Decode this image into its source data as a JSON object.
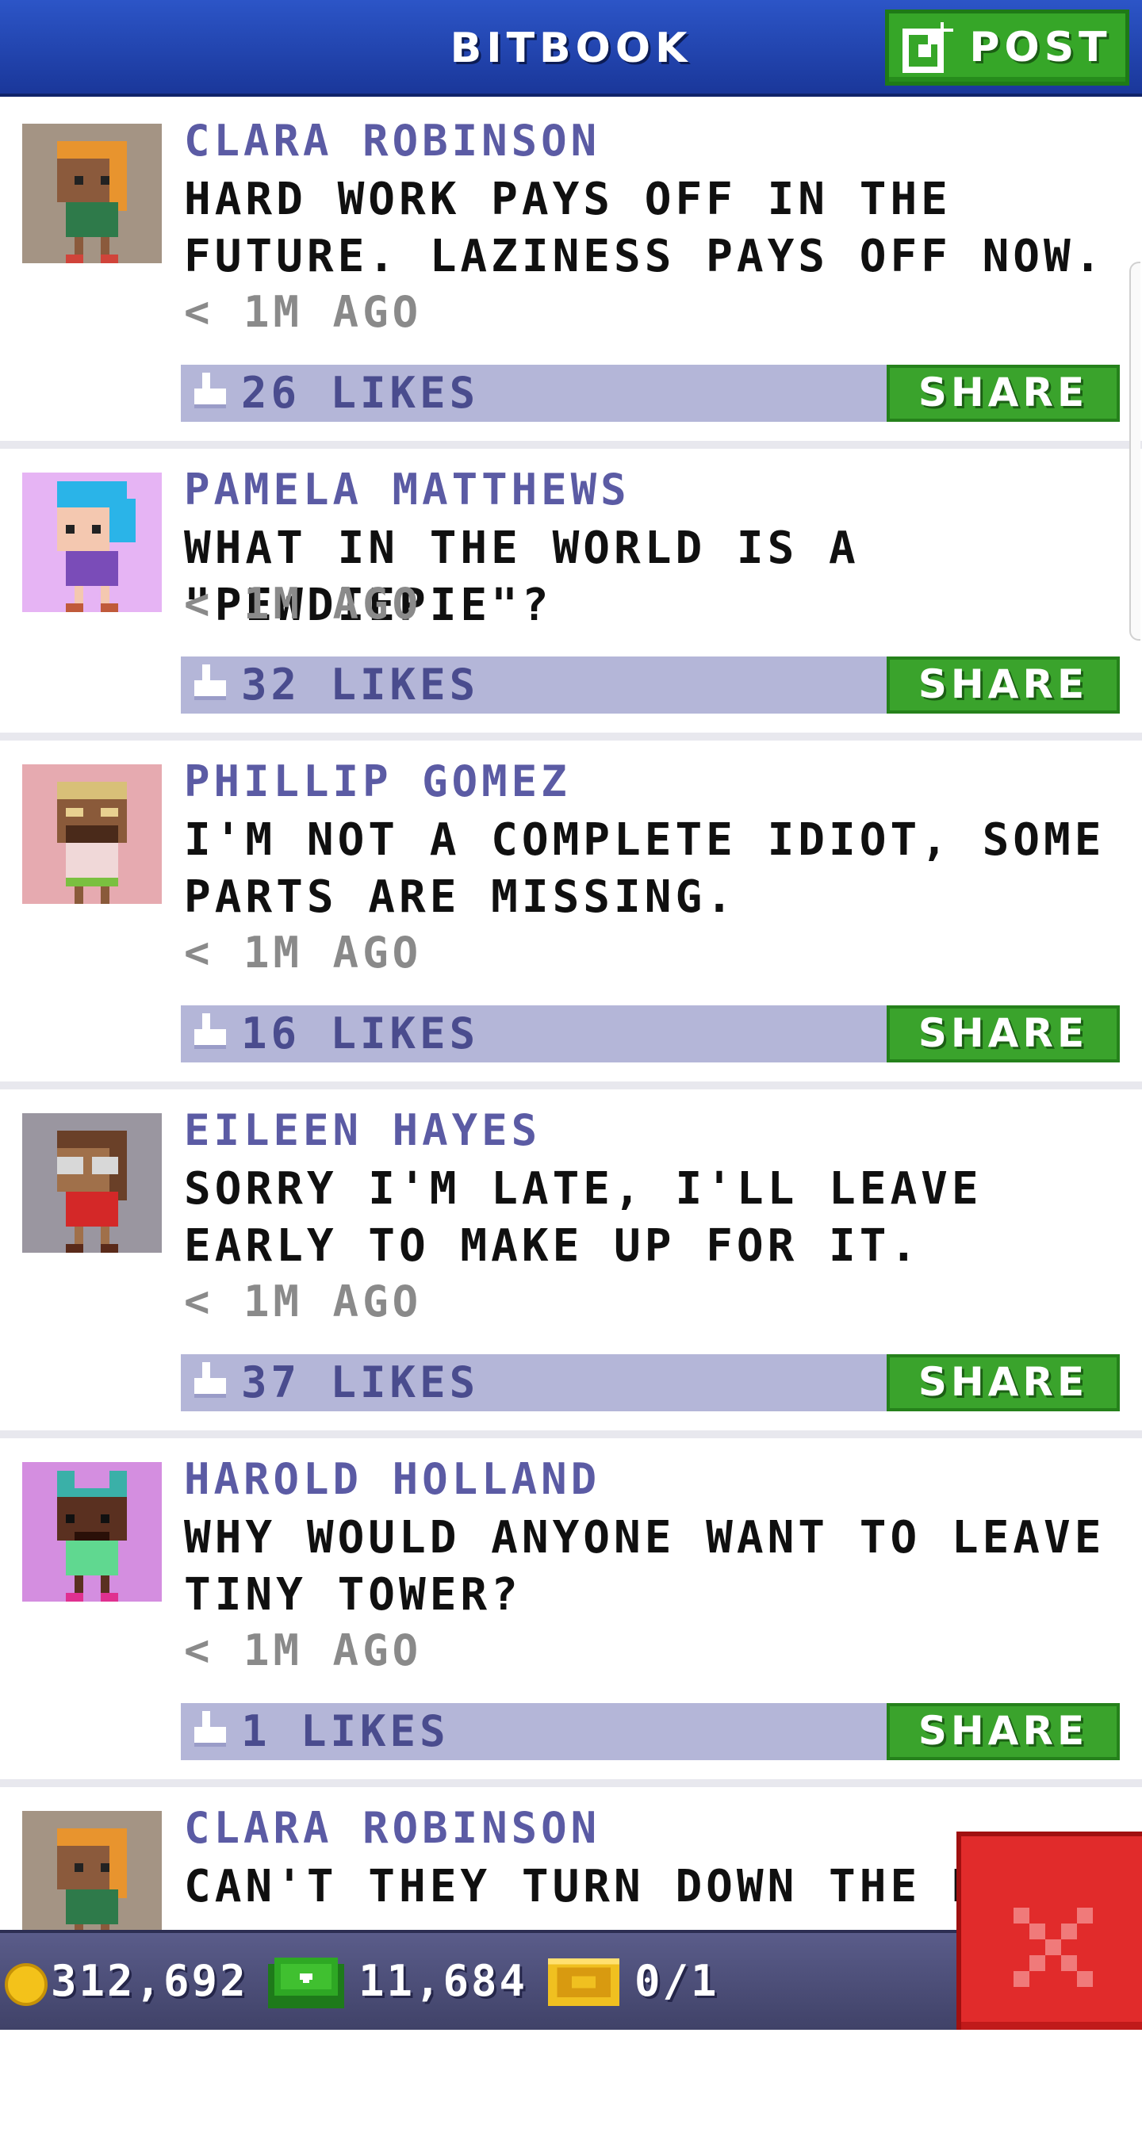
{
  "header": {
    "title": "BITBOOK",
    "post_label": "POST"
  },
  "posts": [
    {
      "author": "CLARA ROBINSON",
      "text": "HARD WORK PAYS OFF IN THE FUTURE. LAZINESS PAYS OFF NOW.",
      "time": "< 1M AGO",
      "likes": "26 LIKES",
      "share_label": "SHARE",
      "avatar_bg": "#a49484"
    },
    {
      "author": "PAMELA MATTHEWS",
      "text": "WHAT IN THE WORLD IS A \"PEWDIEPIE\"?",
      "time": "< 1M AGO",
      "likes": "32 LIKES",
      "share_label": "SHARE",
      "avatar_bg": "#e6b4f4"
    },
    {
      "author": "PHILLIP GOMEZ",
      "text": "I'M NOT A COMPLETE IDIOT, SOME PARTS ARE MISSING.",
      "time": "< 1M AGO",
      "likes": "16 LIKES",
      "share_label": "SHARE",
      "avatar_bg": "#e6aab0"
    },
    {
      "author": "EILEEN HAYES",
      "text": "SORRY I'M LATE, I'LL LEAVE EARLY TO MAKE UP FOR IT.",
      "time": "< 1M AGO",
      "likes": "37 LIKES",
      "share_label": "SHARE",
      "avatar_bg": "#9a96a0"
    },
    {
      "author": "HAROLD HOLLAND",
      "text": "WHY WOULD ANYONE WANT TO LEAVE TINY TOWER?",
      "time": "< 1M AGO",
      "likes": "1 LIKES",
      "share_label": "SHARE",
      "avatar_bg": "#d48ee0"
    },
    {
      "author": "CLARA ROBINSON",
      "text": "CAN'T THEY TURN DOWN THE HE",
      "avatar_bg": "#a49484"
    }
  ],
  "footer": {
    "coins": "312,692",
    "bux": "11,684",
    "tickets": "0/1"
  },
  "colors": {
    "header": "#1f44b0",
    "share": "#3aa32c",
    "likebar": "#b4b6d8",
    "author": "#5b5ba4",
    "close": "#e12b2b"
  },
  "icons": {
    "post": "edit-icon",
    "like": "thumbs-up-icon",
    "coin": "coin-icon",
    "bux": "bux-icon",
    "ticket": "ticket-icon",
    "close": "close-icon"
  }
}
